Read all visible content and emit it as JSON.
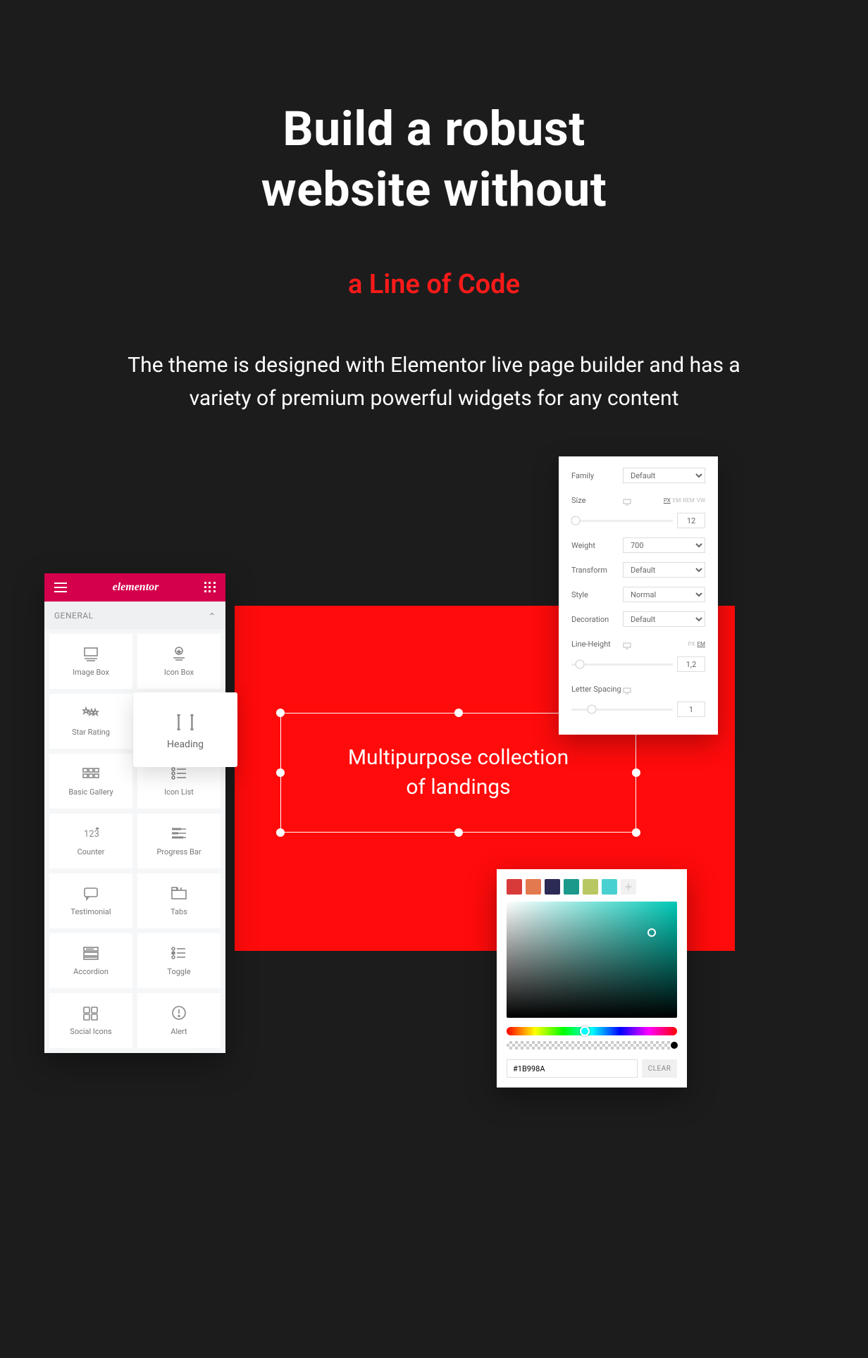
{
  "hero": {
    "title_l1": "Build a robust",
    "title_l2": "website without",
    "subtitle": "a Line of Code",
    "desc": "The theme is designed with Elementor live page builder and has a variety of premium powerful widgets for any content"
  },
  "selection": {
    "text_l1": "Multipurpose collection",
    "text_l2": "of landings"
  },
  "widgets_panel": {
    "logo": "elementor",
    "category": "GENERAL",
    "cards": [
      {
        "label": "Image Box",
        "icon": "img-box"
      },
      {
        "label": "Icon Box",
        "icon": "icon-box"
      },
      {
        "label": "Star Rating",
        "icon": "stars"
      },
      {
        "label": "Heading",
        "icon": "heading"
      },
      {
        "label": "Basic Gallery",
        "icon": "gallery"
      },
      {
        "label": "Icon List",
        "icon": "icon-list"
      },
      {
        "label": "Counter",
        "icon": "counter"
      },
      {
        "label": "Progress Bar",
        "icon": "progress"
      },
      {
        "label": "Testimonial",
        "icon": "testimonial"
      },
      {
        "label": "Tabs",
        "icon": "tabs"
      },
      {
        "label": "Accordion",
        "icon": "accordion"
      },
      {
        "label": "Toggle",
        "icon": "toggle"
      },
      {
        "label": "Social Icons",
        "icon": "social"
      },
      {
        "label": "Alert",
        "icon": "alert"
      }
    ],
    "popup_label": "Heading"
  },
  "typography": {
    "family": {
      "label": "Family",
      "value": "Default"
    },
    "size": {
      "label": "Size",
      "value": "12",
      "units": [
        "PX",
        "EM",
        "REM",
        "VW"
      ],
      "active": "PX"
    },
    "weight": {
      "label": "Weight",
      "value": "700"
    },
    "transform": {
      "label": "Transform",
      "value": "Default"
    },
    "style": {
      "label": "Style",
      "value": "Normal"
    },
    "decoration": {
      "label": "Decoration",
      "value": "Default"
    },
    "lineheight": {
      "label": "Line-Height",
      "value": "1,2",
      "units": [
        "PX",
        "EM"
      ],
      "active": "EM"
    },
    "letterspacing": {
      "label": "Letter Spacing",
      "value": "1"
    }
  },
  "picker": {
    "swatches": [
      "#d83a3a",
      "#e37a4f",
      "#2c2b55",
      "#1b998a",
      "#b8c761",
      "#49d1d1"
    ],
    "hex": "#1B998A",
    "clear": "CLEAR"
  }
}
